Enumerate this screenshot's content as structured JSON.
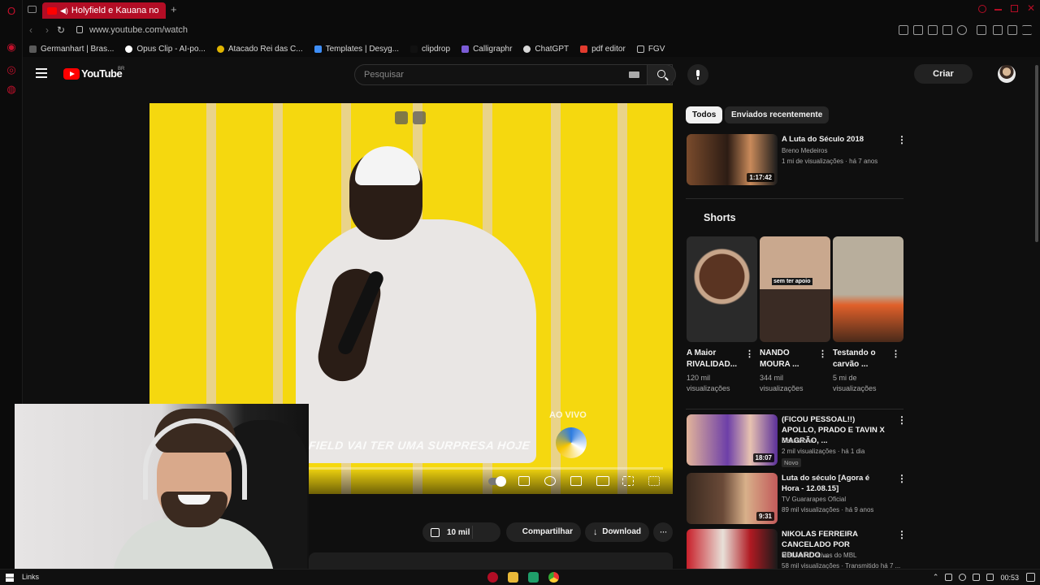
{
  "browser": {
    "active_tab_title": "Holyfield e Kauana no",
    "new_tab_symbol": "+",
    "url": "www.youtube.com/watch"
  },
  "bookmarks": [
    {
      "label": "Germanhart | Bras...",
      "color": "#5a5a5a"
    },
    {
      "label": "Opus Clip - AI-po...",
      "color": "#ffffff"
    },
    {
      "label": "Atacado Rei das C...",
      "color": "#e0b400"
    },
    {
      "label": "Templates | Desyg...",
      "color": "#3e8ef7"
    },
    {
      "label": "clipdrop",
      "color": "#111111"
    },
    {
      "label": "Calligraphr",
      "color": "#7b5cd6"
    },
    {
      "label": "ChatGPT",
      "color": "#d8d8d8"
    },
    {
      "label": "pdf editor",
      "color": "#e23b2e"
    },
    {
      "label": "FGV",
      "color": "#bdbdbd"
    }
  ],
  "youtube": {
    "wordmark": "YouTube",
    "country_code": "BR",
    "search_placeholder": "Pesquisar",
    "create_label": "Criar"
  },
  "video": {
    "lower_third_text": "FIELD VAI TER UMA SURPRESA HOJE",
    "live_label": "AO VIVO",
    "progress_fraction": 0.02,
    "like_count": "10 mil",
    "share_label": "Compartilhar",
    "download_label": "Download",
    "more_symbol": "···"
  },
  "filters": {
    "all_label": "Todos",
    "recent_label": "Enviados recentemente"
  },
  "recommendations_top": [
    {
      "title": "A Luta do Século 2018",
      "channel": "Breno Medeiros",
      "meta": "1 mi de visualizações · há 7 anos",
      "duration": "1:17:42"
    }
  ],
  "shorts": {
    "heading": "Shorts",
    "items": [
      {
        "title": "A Maior RIVALIDAD...",
        "views": "120 mil visualizações"
      },
      {
        "title": "NANDO MOURA ...",
        "views": "344 mil visualizações",
        "caption": "sem ter apoio"
      },
      {
        "title": "Testando o carvão ...",
        "views": "5 mi de visualizações"
      }
    ]
  },
  "recommendations": [
    {
      "title": "(FICOU PESSOAL!!) APOLLO, PRADO E TAVIN X MAGRÃO, ...",
      "channel": "Casalzinho",
      "meta": "2 mil visualizações · há 1 dia",
      "badge": "Novo",
      "duration": "18:07"
    },
    {
      "title": "Luta do século [Agora é Hora - 12.08.15]",
      "channel": "TV Guararapes Oficial",
      "meta": "89 mil visualizações · há 9 anos",
      "duration": "9:31"
    },
    {
      "title": "NIKOLAS FERREIRA CANCELADO POR EDUARDO ...",
      "channel": "MBLiveTV - Lives do MBL",
      "meta": "58 mil visualizações · Transmitido há 7 ..."
    }
  ],
  "taskbar": {
    "links_label": "Links",
    "clock": "00:53"
  },
  "colors": {
    "opera_red": "#b30d25",
    "youtube_red": "#ff0000",
    "video_yellow": "#f5d80f"
  }
}
